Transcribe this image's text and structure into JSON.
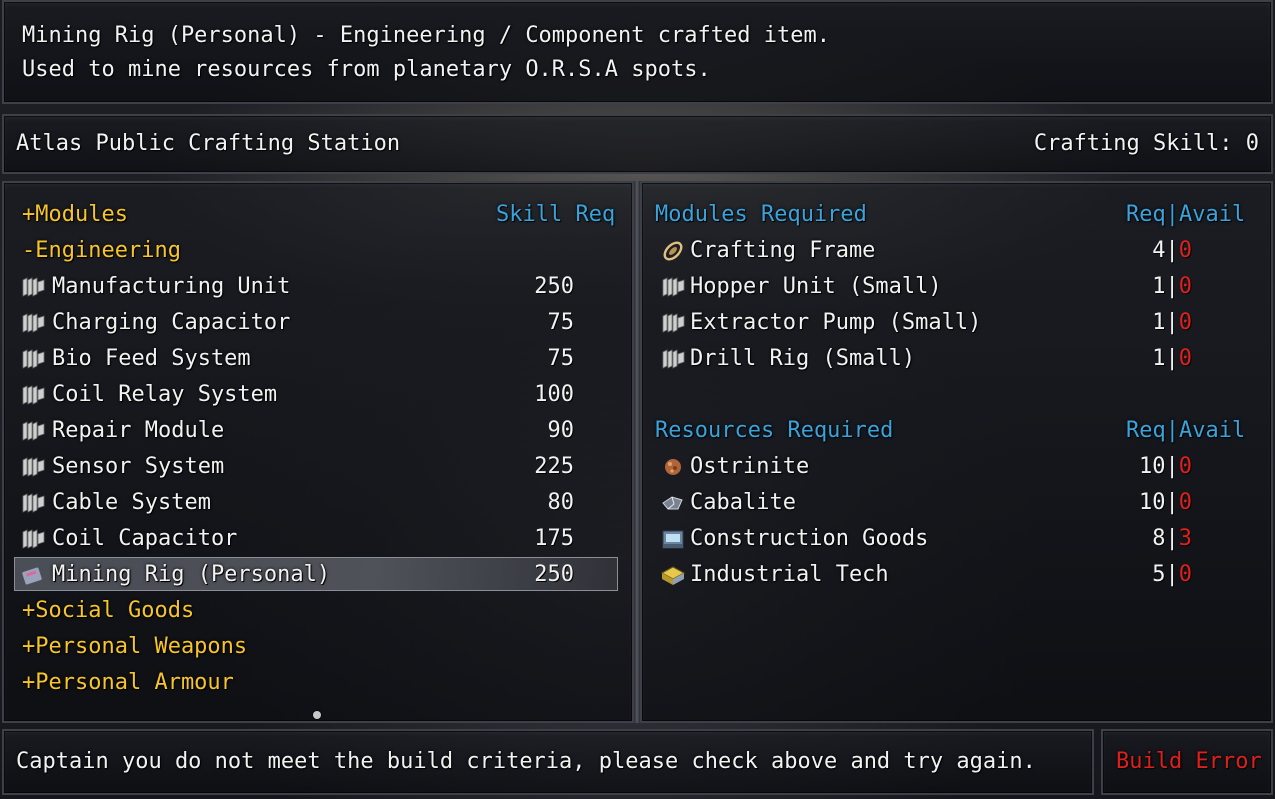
{
  "description": {
    "line1": "Mining Rig (Personal) - Engineering / Component crafted item.",
    "line2": "Used to mine resources from planetary O.R.S.A spots."
  },
  "station": {
    "name": "Atlas Public Crafting Station",
    "skill": "Crafting Skill: 0"
  },
  "recipes": {
    "header_left": "+Modules",
    "header_right": "Skill Req",
    "category": "-Engineering",
    "items": [
      {
        "label": "Manufacturing Unit",
        "skill": "250",
        "icon": "gear-icon"
      },
      {
        "label": "Charging Capacitor",
        "skill": "75",
        "icon": "gear-icon"
      },
      {
        "label": "Bio Feed System",
        "skill": "75",
        "icon": "gear-icon"
      },
      {
        "label": "Coil Relay System",
        "skill": "100",
        "icon": "gear-icon"
      },
      {
        "label": "Repair Module",
        "skill": "90",
        "icon": "gear-icon"
      },
      {
        "label": "Sensor System",
        "skill": "225",
        "icon": "gear-icon"
      },
      {
        "label": "Cable System",
        "skill": "80",
        "icon": "gear-icon"
      },
      {
        "label": "Coil Capacitor",
        "skill": "175",
        "icon": "gear-icon"
      },
      {
        "label": "Mining Rig (Personal)",
        "skill": "250",
        "icon": "mining-rig-icon",
        "selected": true
      }
    ],
    "collapsed": [
      "+Social Goods",
      "+Personal Weapons",
      "+Personal Armour"
    ]
  },
  "modules_required": {
    "header": "Modules Required",
    "col_req": "Req",
    "col_sep": "|",
    "col_avail": "Avail",
    "items": [
      {
        "label": "Crafting Frame",
        "req": "4",
        "avail": "0",
        "icon": "crafting-frame-icon"
      },
      {
        "label": "Hopper Unit (Small)",
        "req": "1",
        "avail": "0",
        "icon": "gear-icon"
      },
      {
        "label": "Extractor Pump (Small)",
        "req": "1",
        "avail": "0",
        "icon": "gear-icon"
      },
      {
        "label": "Drill Rig (Small)",
        "req": "1",
        "avail": "0",
        "icon": "gear-icon"
      }
    ]
  },
  "resources_required": {
    "header": "Resources Required",
    "col_req": "Req",
    "col_sep": "|",
    "col_avail": "Avail",
    "items": [
      {
        "label": "Ostrinite",
        "req": "10",
        "avail": "0",
        "icon": "ore-icon"
      },
      {
        "label": "Cabalite",
        "req": "10",
        "avail": "0",
        "icon": "crystal-icon"
      },
      {
        "label": "Construction Goods",
        "req": "8",
        "avail": "3",
        "icon": "crate-icon"
      },
      {
        "label": "Industrial Tech",
        "req": "5",
        "avail": "0",
        "icon": "tech-icon"
      }
    ]
  },
  "status": {
    "message": "Captain you do not meet the build criteria, please check above and try again.",
    "button": "Build Error"
  },
  "colors": {
    "category": "#f7c52b",
    "header": "#3aa3dc",
    "unavailable": "#e0201c"
  }
}
